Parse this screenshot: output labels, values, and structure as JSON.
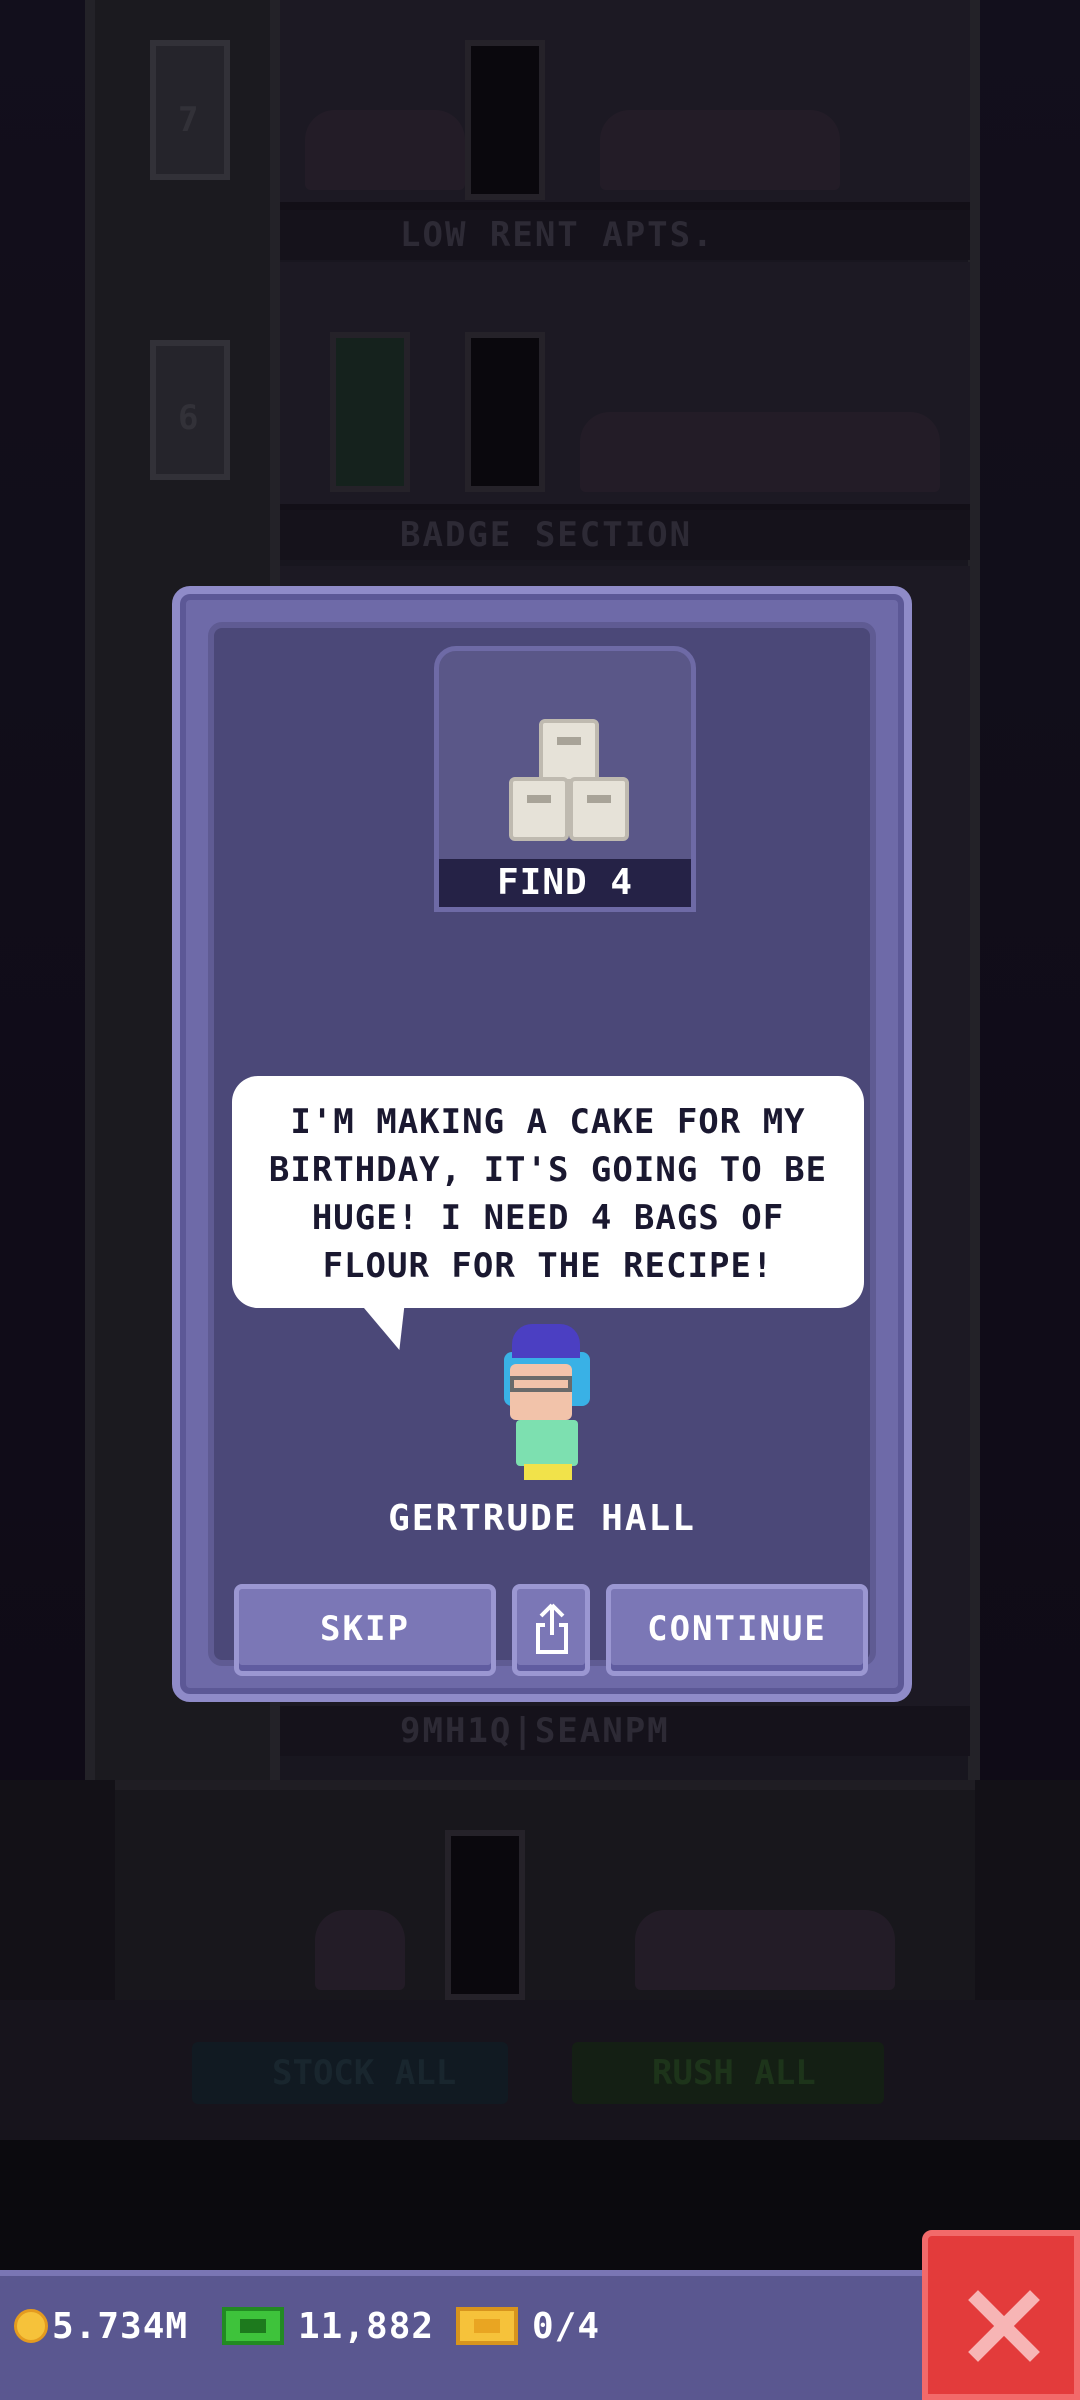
{
  "tower": {
    "floor_labels": [
      "LOW RENT APTS.",
      "BADGE SECTION",
      "9MH1Q|SEANPM"
    ],
    "elevator_numbers": [
      "7",
      "6"
    ],
    "stock_all_label": "STOCK ALL",
    "rush_all_label": "RUSH ALL"
  },
  "mission": {
    "item_icon": "flour-bags-icon",
    "item_label": "FIND 4",
    "speech": "I'M MAKING A CAKE FOR MY BIRTHDAY, IT'S GOING TO BE HUGE! I NEED 4 BAGS OF FLOUR FOR THE RECIPE!",
    "npc_name": "GERTRUDE HALL",
    "skip_label": "SKIP",
    "share_icon": "share-icon",
    "continue_label": "CONTINUE"
  },
  "hud": {
    "coins": "5.734M",
    "bux": "11,882",
    "tickets": "0/4",
    "close_icon": "close-icon"
  },
  "colors": {
    "dialog": "#6e6aa8",
    "dialog_inner": "#4b4878",
    "close_button": "#e33b3b",
    "coin": "#f6c23a",
    "bux": "#3ec33b"
  }
}
